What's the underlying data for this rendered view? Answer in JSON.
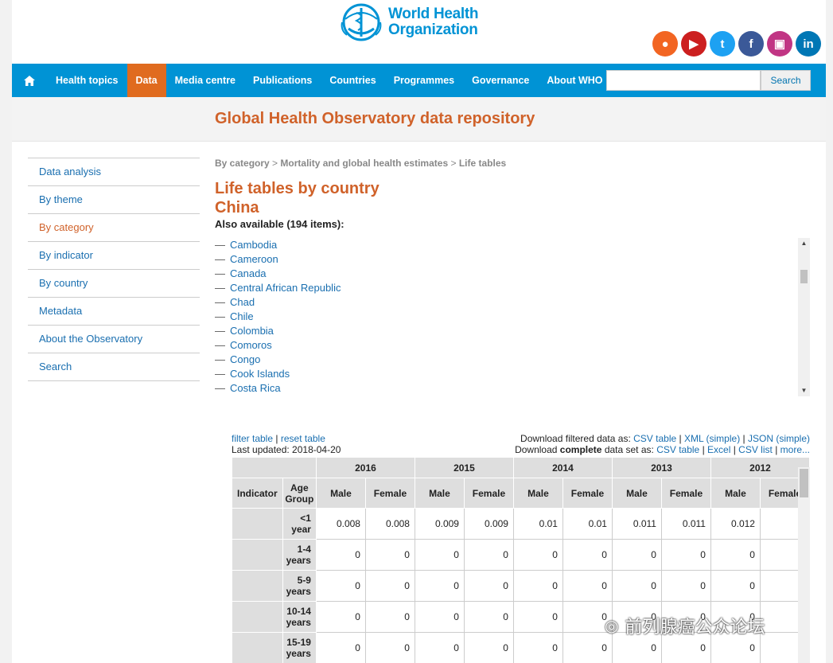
{
  "header": {
    "logo_line1": "World Health",
    "logo_line2": "Organization",
    "social": [
      {
        "icon": "rss-icon",
        "color": "#f26522",
        "glyph": "●"
      },
      {
        "icon": "youtube-icon",
        "color": "#cc1f1f",
        "glyph": "▶"
      },
      {
        "icon": "twitter-icon",
        "color": "#1da1f2",
        "glyph": "t"
      },
      {
        "icon": "facebook-icon",
        "color": "#3b5998",
        "glyph": "f"
      },
      {
        "icon": "instagram-icon",
        "color": "#c13584",
        "glyph": "▣"
      },
      {
        "icon": "linkedin-icon",
        "color": "#0077b5",
        "glyph": "in"
      }
    ]
  },
  "nav": {
    "items": [
      "Health topics",
      "Data",
      "Media centre",
      "Publications",
      "Countries",
      "Programmes",
      "Governance",
      "About WHO"
    ],
    "active_index": 1,
    "search_value": "",
    "search_label": "Search"
  },
  "page_title": "Global Health Observatory data repository",
  "sidebar": {
    "items": [
      "Data analysis",
      "By theme",
      "By category",
      "By indicator",
      "By country",
      "Metadata",
      "About the Observatory",
      "Search"
    ],
    "active_index": 2
  },
  "breadcrumb": {
    "parts": [
      "By category",
      "Mortality and global health estimates",
      "Life tables"
    ],
    "separator": ">"
  },
  "heading": {
    "line1": "Life tables by country",
    "line2": "China"
  },
  "also_available": "Also available (194 items):",
  "countries": [
    "Cambodia",
    "Cameroon",
    "Canada",
    "Central African Republic",
    "Chad",
    "Chile",
    "Colombia",
    "Comoros",
    "Congo",
    "Cook Islands",
    "Costa Rica"
  ],
  "table_links": {
    "filter": "filter table",
    "sep": "|",
    "reset": "reset table",
    "updated": "Last updated: 2018-04-20"
  },
  "downloads": {
    "filtered_prefix": "Download filtered data as:",
    "filtered": [
      "CSV table",
      "XML (simple)",
      "JSON (simple)"
    ],
    "complete_prefix_a": "Download",
    "complete_prefix_b": "complete",
    "complete_prefix_c": "data set as:",
    "complete": [
      "CSV table",
      "Excel",
      "CSV list",
      "more..."
    ]
  },
  "table": {
    "indicator_header": "Indicator",
    "age_header": "Age Group",
    "years": [
      "2016",
      "2015",
      "2014",
      "2013",
      "2012"
    ],
    "sex": [
      "Male",
      "Female"
    ],
    "rows": [
      {
        "age": "<1 year",
        "values": [
          "0.008",
          "0.008",
          "0.009",
          "0.009",
          "0.01",
          "0.01",
          "0.011",
          "0.011",
          "0.012",
          ""
        ]
      },
      {
        "age": "1-4 years",
        "values": [
          "0",
          "0",
          "0",
          "0",
          "0",
          "0",
          "0",
          "0",
          "0",
          ""
        ]
      },
      {
        "age": "5-9 years",
        "values": [
          "0",
          "0",
          "0",
          "0",
          "0",
          "0",
          "0",
          "0",
          "0",
          ""
        ]
      },
      {
        "age": "10-14 years",
        "values": [
          "0",
          "0",
          "0",
          "0",
          "0",
          "0",
          "0",
          "0",
          "0",
          ""
        ]
      },
      {
        "age": "15-19 years",
        "values": [
          "0",
          "0",
          "0",
          "0",
          "0",
          "0",
          "0",
          "0",
          "0",
          ""
        ]
      }
    ]
  },
  "watermark": "前列腺癌公众论坛"
}
